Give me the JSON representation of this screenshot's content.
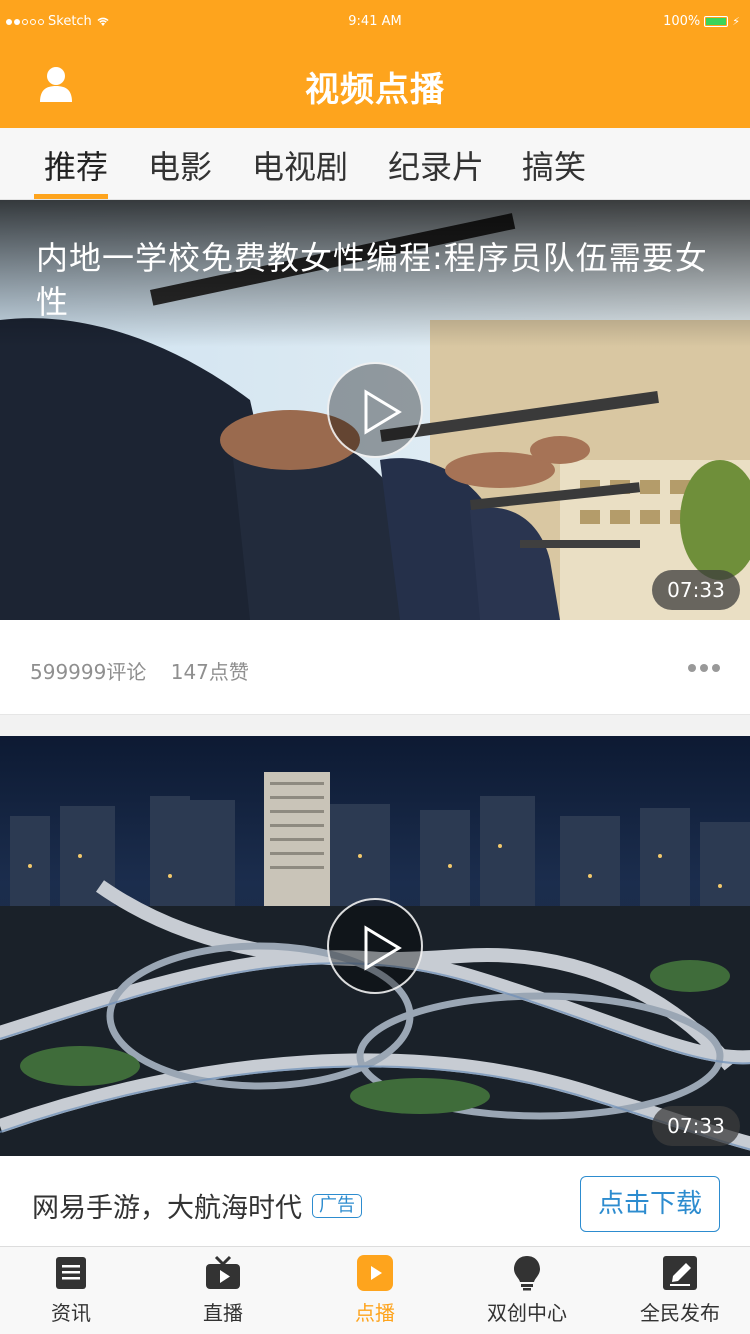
{
  "status_bar": {
    "carrier": "Sketch",
    "time": "9:41 AM",
    "battery": "100%"
  },
  "nav": {
    "title": "视频点播"
  },
  "tabs": [
    {
      "label": "推荐",
      "active": true
    },
    {
      "label": "电影",
      "active": false
    },
    {
      "label": "电视剧",
      "active": false
    },
    {
      "label": "纪录片",
      "active": false
    },
    {
      "label": "搞笑",
      "active": false
    }
  ],
  "feed": {
    "video1": {
      "title": "内地一学校免费教女性编程:程序员队伍需要女性",
      "duration": "07:33",
      "comments": "599999评论",
      "likes": "147点赞"
    },
    "video2": {
      "duration": "07:33"
    },
    "ad": {
      "title": "网易手游，大航海时代",
      "badge": "广告",
      "button": "点击下载"
    }
  },
  "tabbar": [
    {
      "label": "资讯",
      "icon": "document-icon",
      "active": false
    },
    {
      "label": "直播",
      "icon": "tv-icon",
      "active": false
    },
    {
      "label": "点播",
      "icon": "play-icon",
      "active": true
    },
    {
      "label": "双创中心",
      "icon": "bulb-icon",
      "active": false
    },
    {
      "label": "全民发布",
      "icon": "edit-icon",
      "active": false
    }
  ],
  "colors": {
    "primary": "#FEA41D",
    "link": "#2D8CCF"
  }
}
